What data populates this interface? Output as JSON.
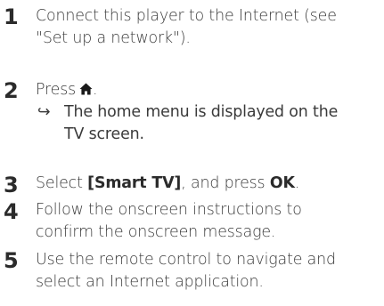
{
  "steps": [
    {
      "number": "1",
      "lines": [
        "Connect this player to the Internet (see",
        "\"Set up a network\")."
      ]
    },
    {
      "number": "2",
      "text": "Press",
      "icon": "home-icon",
      "suffix": ".",
      "result_arrow": "↪",
      "result_lines": [
        "The home menu is displayed on the",
        "TV screen."
      ]
    },
    {
      "number": "3",
      "prefix": "Select ",
      "bold_1": "[Smart TV]",
      "middle": ", and press ",
      "bold_2": "OK",
      "suffix": "."
    },
    {
      "number": "4",
      "lines": [
        "Follow the onscreen instructions to",
        "confirm the onscreen message."
      ]
    },
    {
      "number": "5",
      "lines": [
        "Use the remote control to navigate and",
        "select an Internet application."
      ]
    }
  ]
}
